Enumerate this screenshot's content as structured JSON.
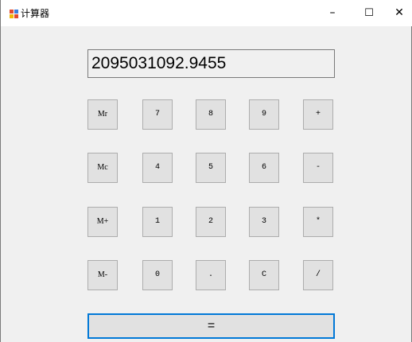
{
  "window": {
    "title": "计算器",
    "minimize_glyph": "–",
    "maximize_glyph": "☐",
    "close_glyph": "✕",
    "icon": "app-window-icon"
  },
  "display": {
    "value": "2095031092.9455"
  },
  "buttons": {
    "mr": "Mr",
    "mc": "Mc",
    "mplus": "M+",
    "mminus": "M-",
    "n7": "7",
    "n8": "8",
    "n9": "9",
    "plus": "+",
    "n4": "4",
    "n5": "5",
    "n6": "6",
    "minus": "-",
    "n1": "1",
    "n2": "2",
    "n3": "3",
    "multiply": "*",
    "n0": "0",
    "dot": ".",
    "clear": "C",
    "divide": "/",
    "equals": "="
  },
  "colors": {
    "focus_border": "#0078d7",
    "button_face": "#e1e1e1",
    "window_bg": "#f0f0f0"
  }
}
